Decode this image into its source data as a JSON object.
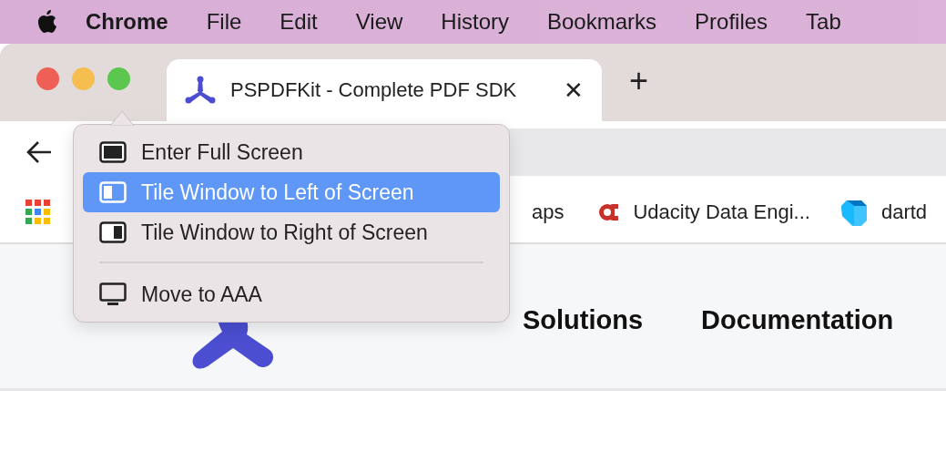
{
  "menu_bar": {
    "app": "Chrome",
    "items": [
      "File",
      "Edit",
      "View",
      "History",
      "Bookmarks",
      "Profiles",
      "Tab"
    ]
  },
  "tab": {
    "title": "PSPDFKit - Complete PDF SDK",
    "selected": true,
    "close": "✕"
  },
  "new_tab": "+",
  "bookmarks": [
    {
      "kind": "text",
      "label": "aps"
    },
    {
      "kind": "udacity",
      "label": "Udacity Data Engi..."
    },
    {
      "kind": "dart",
      "label": "dartd"
    }
  ],
  "page_nav": [
    "Solutions",
    "Documentation"
  ],
  "window_menu": [
    {
      "kind": "fullscreen",
      "label": "Enter Full Screen",
      "selected": false
    },
    {
      "kind": "tile-left",
      "label": "Tile Window to Left of Screen",
      "selected": true
    },
    {
      "kind": "tile-right",
      "label": "Tile Window to Right of Screen",
      "selected": false
    },
    {
      "kind": "separator"
    },
    {
      "kind": "display",
      "label": "Move to AAA",
      "selected": false
    }
  ]
}
